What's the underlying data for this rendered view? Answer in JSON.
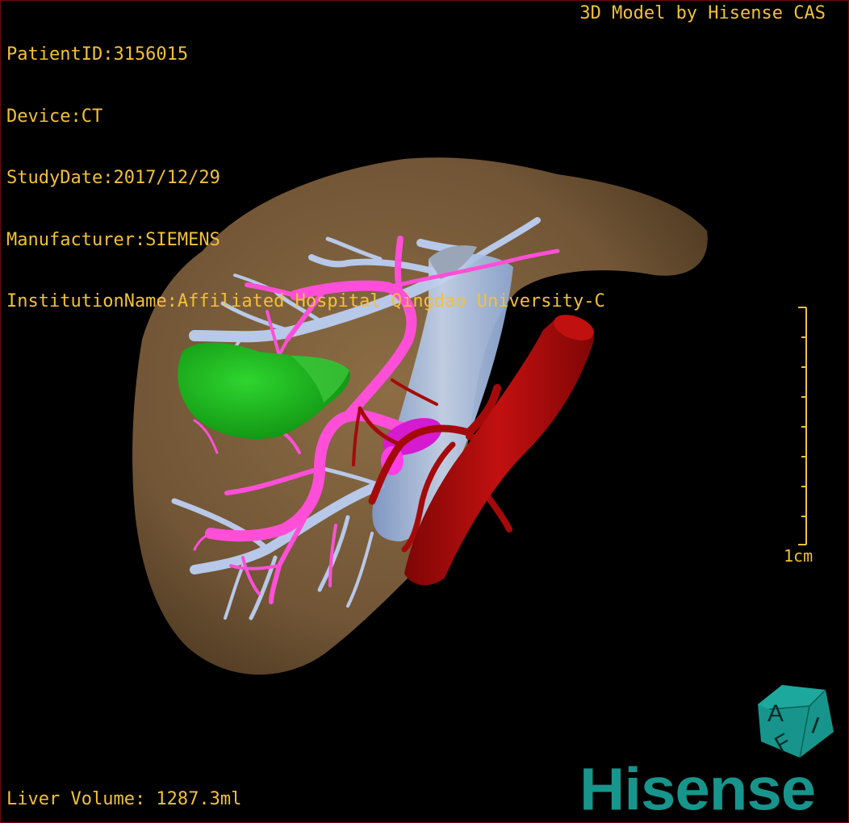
{
  "overlay": {
    "patient_id": "PatientID:3156015",
    "device": "Device:CT",
    "study_date": "StudyDate:2017/12/29",
    "manufacturer": "Manufacturer:SIEMENS",
    "institution": "InstitutionName:Affiliated Hospital Qingdao University-C",
    "brand_text": "3D Model by Hisense CAS",
    "volume": "Liver Volume: 1287.3ml",
    "scale_label": "1cm"
  },
  "logo": {
    "cube_letters": [
      "A",
      "I",
      "F"
    ],
    "wordmark": "Hisense"
  },
  "colors": {
    "overlay_text": "#f2c03a",
    "liver": "#7a5e3a",
    "portal_vein": "#ff4fd8",
    "hepatic_vein": "#b8c8e8",
    "ivc": "#9fb7de",
    "artery": "#a50a0a",
    "tumor": "#1fb21f",
    "brand": "#17958c"
  },
  "icons": [
    "scale-bar-icon",
    "aif-logo-icon"
  ]
}
